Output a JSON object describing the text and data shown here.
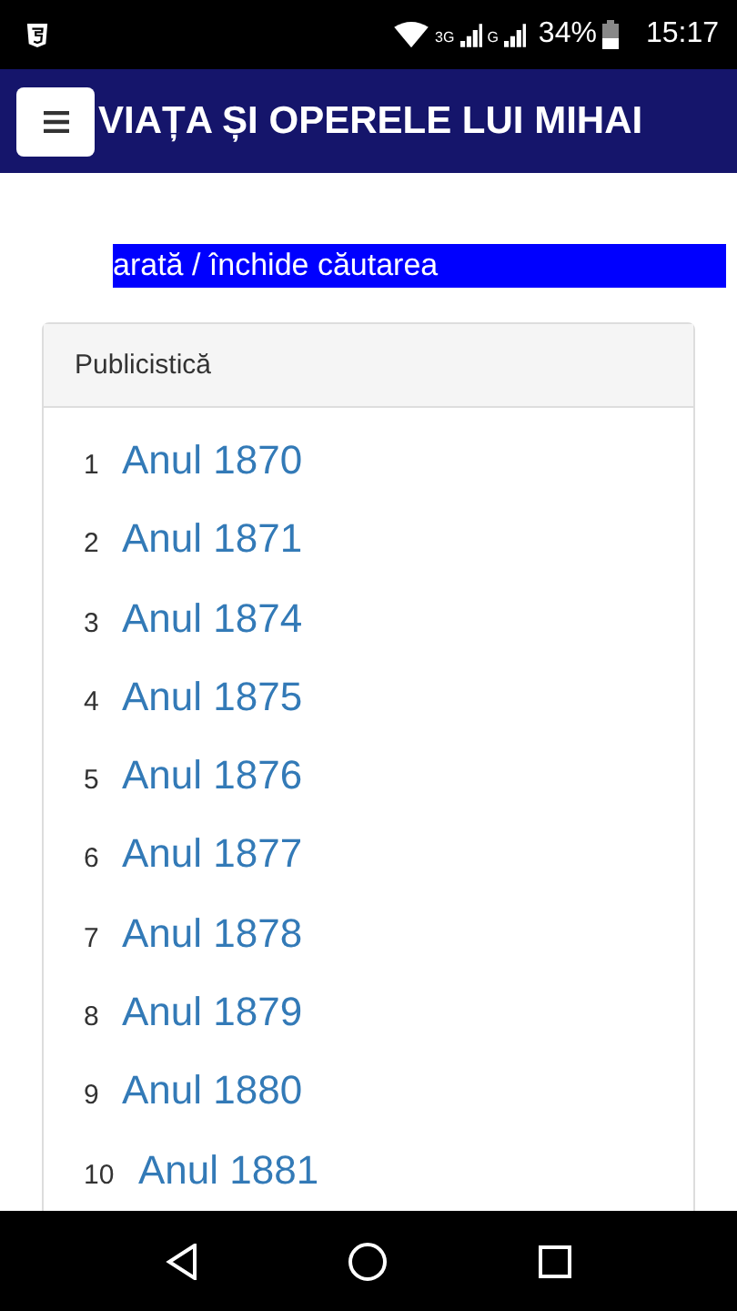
{
  "status_bar": {
    "network_1": "3G",
    "network_2": "G",
    "battery": "34%",
    "time": "15:17"
  },
  "header": {
    "title": "VIAȚA ȘI OPERELE LUI MIHAI"
  },
  "search_toggle": {
    "label": "arată / închide căutarea"
  },
  "panel": {
    "title": "Publicistică",
    "items": [
      {
        "number": "1",
        "label": "Anul 1870"
      },
      {
        "number": "2",
        "label": "Anul 1871"
      },
      {
        "number": "3",
        "label": "Anul 1874"
      },
      {
        "number": "4",
        "label": "Anul 1875"
      },
      {
        "number": "5",
        "label": "Anul 1876"
      },
      {
        "number": "6",
        "label": "Anul 1877"
      },
      {
        "number": "7",
        "label": "Anul 1878"
      },
      {
        "number": "8",
        "label": "Anul 1879"
      },
      {
        "number": "9",
        "label": "Anul 1880"
      },
      {
        "number": "10",
        "label": "Anul 1881"
      }
    ]
  }
}
